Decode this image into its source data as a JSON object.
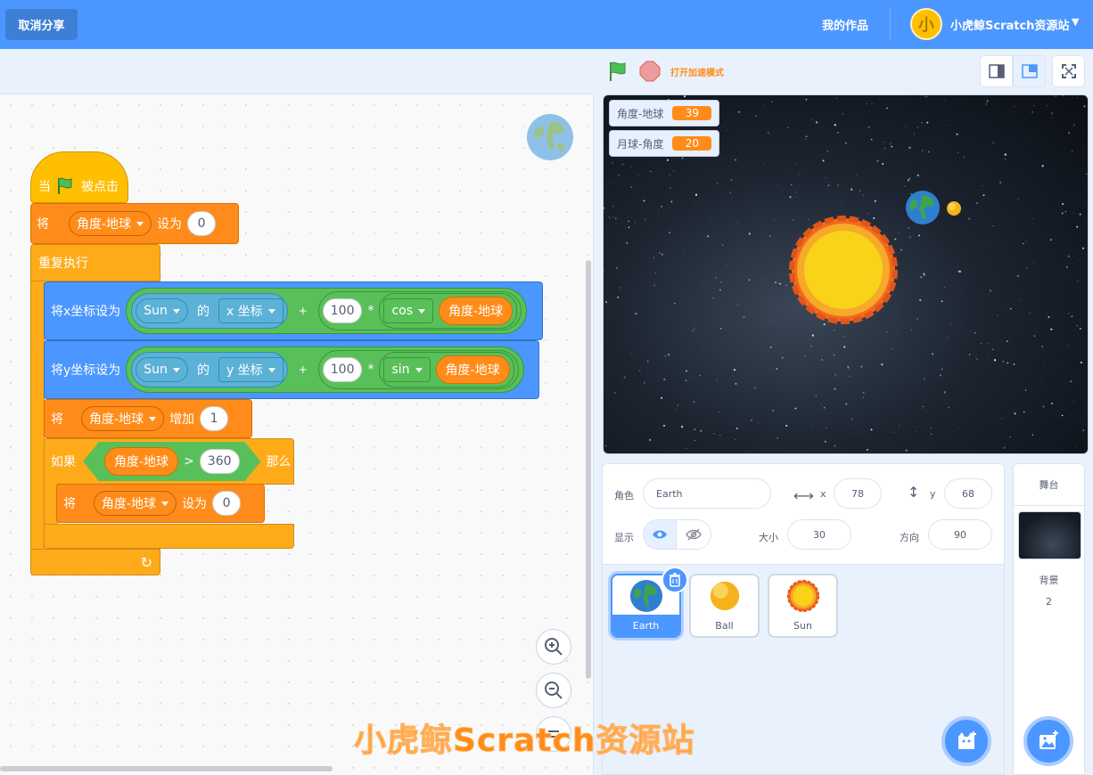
{
  "topbar": {
    "unshare_label": "取消分享",
    "my_works_label": "我的作品",
    "avatar_text": "小",
    "username": "小虎鲸Scratch资源站"
  },
  "stage_controls": {
    "turbo_label": "打开加速模式"
  },
  "code": {
    "hat": {
      "when": "当",
      "clicked": "被点击"
    },
    "set1": {
      "label": "将",
      "var": "角度-地球",
      "to": "设为",
      "value": "0"
    },
    "forever": "重复执行",
    "setx": {
      "label": "将x坐标设为",
      "sprite": "Sun",
      "of": "的",
      "attr": "x 坐标",
      "plus": "+",
      "factor": "100",
      "times": "*",
      "func": "cos",
      "var": "角度-地球"
    },
    "sety": {
      "label": "将y坐标设为",
      "sprite": "Sun",
      "of": "的",
      "attr": "y 坐标",
      "plus": "+",
      "factor": "100",
      "times": "*",
      "func": "sin",
      "var": "角度-地球"
    },
    "change": {
      "label": "将",
      "var": "角度-地球",
      "by": "增加",
      "value": "1"
    },
    "if_block": {
      "if": "如果",
      "var": "角度-地球",
      "op": ">",
      "value": "360",
      "then": "那么"
    },
    "set2": {
      "label": "将",
      "var": "角度-地球",
      "to": "设为",
      "value": "0"
    },
    "loop_arrow": "↻"
  },
  "monitors": [
    {
      "name": "角度-地球",
      "value": "39"
    },
    {
      "name": "月球-角度",
      "value": "20"
    }
  ],
  "sprite_info": {
    "sprite_label": "角色",
    "sprite_name": "Earth",
    "x_label": "x",
    "x_value": "78",
    "y_label": "y",
    "y_value": "68",
    "show_label": "显示",
    "size_label": "大小",
    "size_value": "30",
    "direction_label": "方向",
    "direction_value": "90"
  },
  "sprites": [
    {
      "name": "Earth",
      "selected": true
    },
    {
      "name": "Ball",
      "selected": false
    },
    {
      "name": "Sun",
      "selected": false
    }
  ],
  "stage_panel": {
    "title": "舞台",
    "backdrop_label": "背景",
    "backdrop_count": "2"
  },
  "watermark": "小虎鲸Scratch资源站",
  "colors": {
    "menu_bar": "#4c97ff",
    "events": "#ffbf00",
    "variables": "#ff8c1a",
    "control": "#ffab19",
    "motion": "#4c97ff",
    "operators": "#59c059",
    "sensing": "#5cb1d6"
  }
}
